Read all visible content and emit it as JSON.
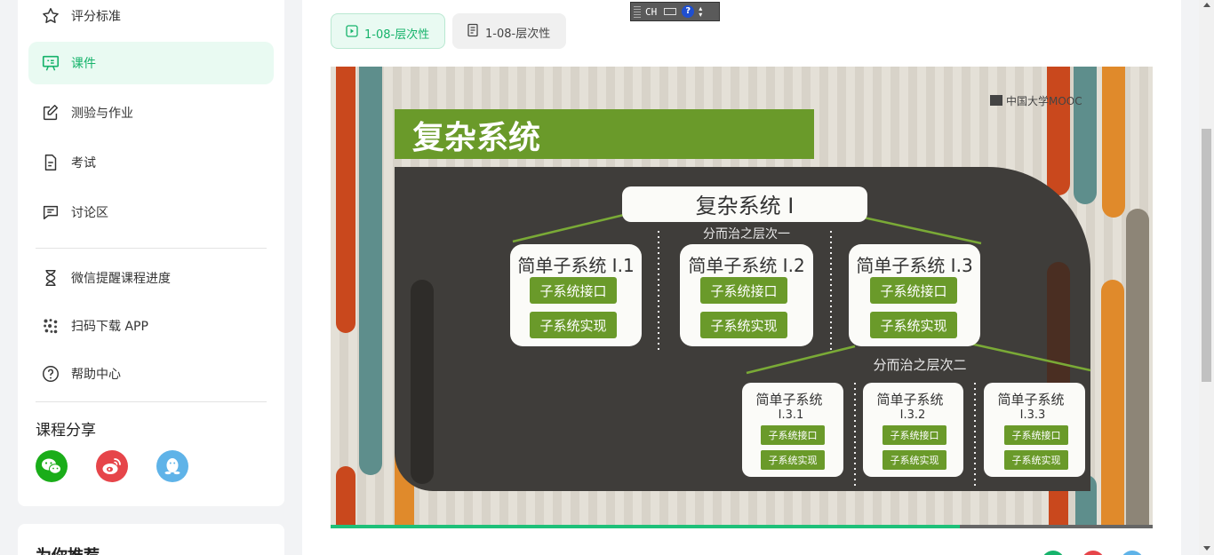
{
  "sidebar": {
    "items": [
      {
        "label": "评分标准",
        "icon": "star-icon"
      },
      {
        "label": "课件",
        "icon": "courseware-icon",
        "active": true
      },
      {
        "label": "测验与作业",
        "icon": "edit-icon"
      },
      {
        "label": "考试",
        "icon": "document-icon"
      },
      {
        "label": "讨论区",
        "icon": "chat-icon"
      }
    ],
    "tools": [
      {
        "label": "微信提醒课程进度",
        "icon": "hourglass-icon"
      },
      {
        "label": "扫码下载 APP",
        "icon": "qrcode-icon"
      },
      {
        "label": "帮助中心",
        "icon": "help-icon"
      }
    ],
    "share_title": "课程分享",
    "share_icons": [
      "wechat-icon",
      "weibo-icon",
      "qq-icon"
    ],
    "recommend_title": "为你推荐"
  },
  "tabs": [
    {
      "label": "1-08-层次性",
      "icon": "play-icon",
      "active": true
    },
    {
      "label": "1-08-层次性",
      "icon": "doc-icon",
      "active": false
    }
  ],
  "ime": {
    "label": "CH",
    "help": "?"
  },
  "slide": {
    "logo": "中国大学MOOC",
    "title": "复杂系统",
    "root": "复杂系统 I",
    "level1_label": "分而治之层次一",
    "level2_label": "分而治之层次二",
    "sub1": [
      {
        "name": "简单子系统 I.1"
      },
      {
        "name": "简单子系统 I.2"
      },
      {
        "name": "简单子系统 I.3"
      }
    ],
    "sub2": [
      {
        "name_line1": "简单子系统",
        "name_line2": "I.3.1"
      },
      {
        "name_line1": "简单子系统",
        "name_line2": "I.3.2"
      },
      {
        "name_line1": "简单子系统",
        "name_line2": "I.3.3"
      }
    ],
    "interface_label": "子系统接口",
    "impl_label": "子系统实现"
  },
  "player": {
    "progress": 0.765
  },
  "colors": {
    "accent": "#16b36b",
    "accent_bg": "#e9faf2",
    "slide_green": "#6a9a2a"
  }
}
